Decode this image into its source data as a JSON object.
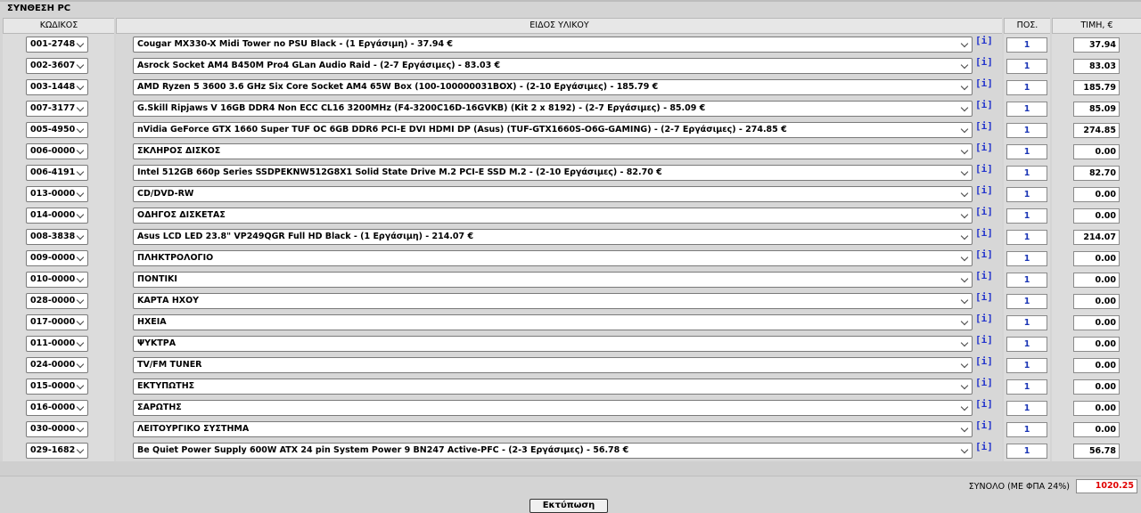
{
  "title": "ΣΥΝΘΕΣΗ PC",
  "headers": {
    "code": "ΚΩΔΙΚΟΣ",
    "item": "ΕΙΔΟΣ ΥΛΙΚΟΥ",
    "qty": "ΠΟΣ.",
    "price": "ΤΙΜΗ, €"
  },
  "info_label": "[i]",
  "rows": [
    {
      "code": "001-2748",
      "item": "Cougar MX330-X Midi Tower no PSU Black - (1 Εργάσιμη) - 37.94 €",
      "qty": "1",
      "price": "37.94"
    },
    {
      "code": "002-3607",
      "item": "Asrock Socket AM4 B450M Pro4 GLan Audio Raid - (2-7 Εργάσιμες) - 83.03 €",
      "qty": "1",
      "price": "83.03"
    },
    {
      "code": "003-1448",
      "item": "AMD Ryzen 5 3600 3.6 GHz Six Core Socket AM4 65W Box (100-100000031BOX) - (2-10 Εργάσιμες) - 185.79 €",
      "qty": "1",
      "price": "185.79"
    },
    {
      "code": "007-3177",
      "item": "G.Skill Ripjaws V 16GB DDR4 Non ECC CL16 3200MHz (F4-3200C16D-16GVKB) (Kit 2 x 8192) - (2-7 Εργάσιμες) - 85.09 €",
      "qty": "1",
      "price": "85.09"
    },
    {
      "code": "005-4950",
      "item": "nVidia GeForce GTX 1660 Super TUF OC 6GB DDR6 PCI-E DVI HDMI DP (Asus) (TUF-GTX1660S-O6G-GAMING) - (2-7 Εργάσιμες) - 274.85 €",
      "qty": "1",
      "price": "274.85"
    },
    {
      "code": "006-0000",
      "item": "ΣΚΛΗΡΟΣ ΔΙΣΚΟΣ",
      "qty": "1",
      "price": "0.00"
    },
    {
      "code": "006-4191",
      "item": "Intel 512GB 660p Series SSDPEKNW512G8X1 Solid State Drive M.2 PCI-E SSD M.2 - (2-10 Εργάσιμες) - 82.70 €",
      "qty": "1",
      "price": "82.70"
    },
    {
      "code": "013-0000",
      "item": "CD/DVD-RW",
      "qty": "1",
      "price": "0.00"
    },
    {
      "code": "014-0000",
      "item": "ΟΔΗΓΟΣ ΔΙΣΚΕΤΑΣ",
      "qty": "1",
      "price": "0.00"
    },
    {
      "code": "008-3838",
      "item": "Asus LCD LED 23.8\" VP249QGR Full HD Black - (1 Εργάσιμη) - 214.07 €",
      "qty": "1",
      "price": "214.07"
    },
    {
      "code": "009-0000",
      "item": "ΠΛΗΚΤΡΟΛΟΓΙΟ",
      "qty": "1",
      "price": "0.00"
    },
    {
      "code": "010-0000",
      "item": "ΠΟΝΤΙΚΙ",
      "qty": "1",
      "price": "0.00"
    },
    {
      "code": "028-0000",
      "item": "ΚΑΡΤΑ ΗΧΟΥ",
      "qty": "1",
      "price": "0.00"
    },
    {
      "code": "017-0000",
      "item": "ΗΧΕΙΑ",
      "qty": "1",
      "price": "0.00"
    },
    {
      "code": "011-0000",
      "item": "ΨΥΚΤΡΑ",
      "qty": "1",
      "price": "0.00"
    },
    {
      "code": "024-0000",
      "item": "TV/FM TUNER",
      "qty": "1",
      "price": "0.00"
    },
    {
      "code": "015-0000",
      "item": "ΕΚΤΥΠΩΤΗΣ",
      "qty": "1",
      "price": "0.00"
    },
    {
      "code": "016-0000",
      "item": "ΣΑΡΩΤΗΣ",
      "qty": "1",
      "price": "0.00"
    },
    {
      "code": "030-0000",
      "item": "ΛΕΙΤΟΥΡΓΙΚΟ ΣΥΣΤΗΜΑ",
      "qty": "1",
      "price": "0.00"
    },
    {
      "code": "029-1682",
      "item": "Be Quiet Power Supply 600W ATX 24 pin System Power 9 BN247 Active-PFC - (2-3 Εργάσιμες) - 56.78 €",
      "qty": "1",
      "price": "56.78"
    }
  ],
  "total": {
    "label": "ΣΥΝΟΛΟ (ΜΕ ΦΠΑ 24%)",
    "value": "1020.25"
  },
  "print_label": "Εκτύπωση",
  "colors": {
    "total_value": "#e00000",
    "qty_text": "#1a35b5",
    "info_link": "#2233cc"
  }
}
